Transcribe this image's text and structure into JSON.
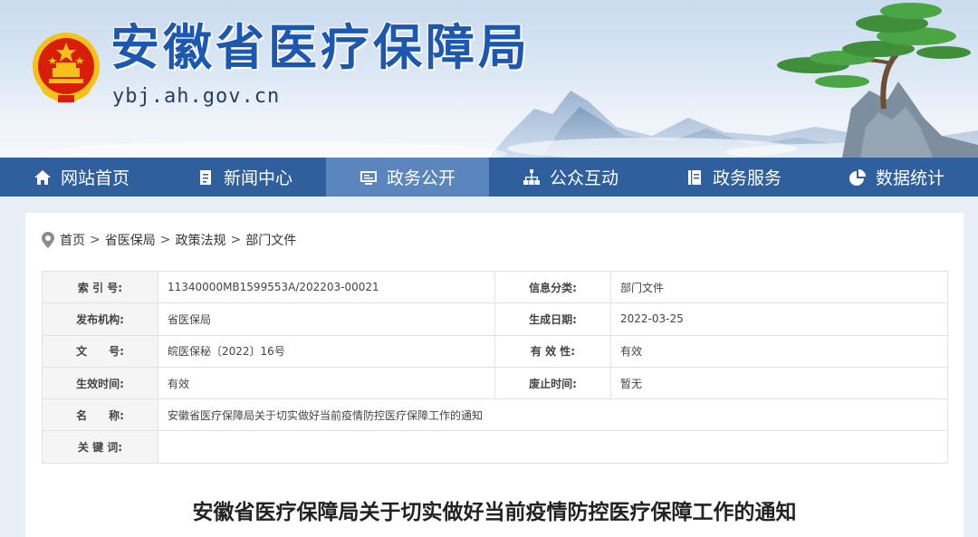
{
  "header": {
    "title": "安徽省医疗保障局",
    "domain": "ybj.ah.gov.cn"
  },
  "nav": [
    {
      "label": "网站首页",
      "icon": "home-icon"
    },
    {
      "label": "新闻中心",
      "icon": "document-icon"
    },
    {
      "label": "政务公开",
      "icon": "monitor-icon",
      "active": true
    },
    {
      "label": "公众互动",
      "icon": "network-icon"
    },
    {
      "label": "政务服务",
      "icon": "book-icon"
    },
    {
      "label": "数据统计",
      "icon": "pie-chart-icon"
    }
  ],
  "breadcrumb": {
    "icon": "location-pin-icon",
    "items": [
      "首页",
      "省医保局",
      "政策法规",
      "部门文件"
    ],
    "separator": ">"
  },
  "meta": {
    "index_label": "索 引 号:",
    "index_value": "11340000MB1599553A/202203-00021",
    "category_label": "信息分类:",
    "category_value": "部门文件",
    "publisher_label": "发布机构:",
    "publisher_value": "省医保局",
    "date_label": "生成日期:",
    "date_value": "2022-03-25",
    "docno_label": "文　　号:",
    "docno_value": "皖医保秘〔2022〕16号",
    "validity_label": "有 效 性:",
    "validity_value": "有效",
    "effective_label": "生效时间:",
    "effective_value": "有效",
    "repeal_label": "废止时间:",
    "repeal_value": "暂无",
    "name_label": "名　　称:",
    "name_value": "安徽省医疗保障局关于切实做好当前疫情防控医疗保障工作的通知",
    "keywords_label": "关 键 词:",
    "keywords_value": ""
  },
  "article": {
    "title": "安徽省医疗保障局关于切实做好当前疫情防控医疗保障工作的通知"
  },
  "colors": {
    "nav_bg": "#2f5f9d",
    "nav_active": "#5b85bd",
    "title_blue": "#1c58b0",
    "emblem_red": "#d81e06",
    "emblem_gold": "#f4c21a"
  }
}
